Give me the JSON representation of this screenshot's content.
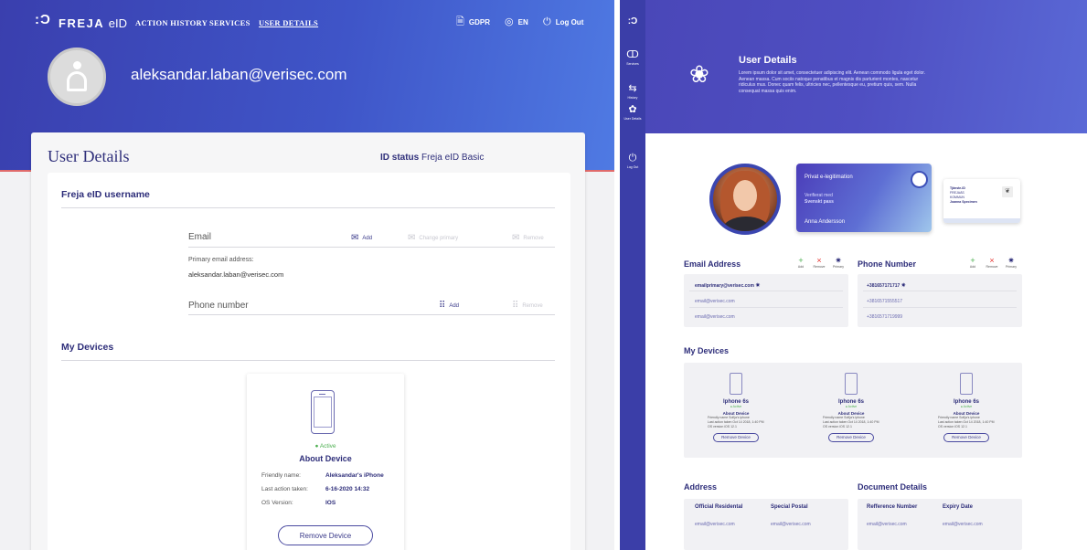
{
  "left": {
    "brand": {
      "glyph": ":Ɔ",
      "name": "FREJA",
      "suffix": "eID"
    },
    "nav": [
      {
        "label": "ACTION HISTORY"
      },
      {
        "label": "SERVICES"
      },
      {
        "label": "USER DETAILS"
      }
    ],
    "nav_right": {
      "gdpr": {
        "icon": "🗎",
        "label": "GDPR"
      },
      "lang": {
        "icon": "◎",
        "label": "EN"
      },
      "logout": {
        "icon": "⏻",
        "label": "Log Out"
      }
    },
    "hero_email": "aleksandar.laban@verisec.com",
    "card_title": "User Details",
    "id_status": {
      "label": "ID status",
      "value": "Freja eID Basic"
    },
    "username_section": "Freja eID username",
    "email_label": "Email",
    "email_actions": {
      "add": "Add",
      "change_primary": "Change primary",
      "remove": "Remove",
      "mail_icon": "✉"
    },
    "primary_email_label": "Primary email address:",
    "primary_email_value": "aleksandar.laban@verisec.com",
    "phone_label": "Phone number",
    "phone_actions": {
      "add": "Add",
      "remove": "Remove",
      "keypad_icon": "⠿"
    },
    "devices_section": "My Devices",
    "device": {
      "status": "● Active",
      "about": "About Device",
      "rows": [
        {
          "k": "Friendly name:",
          "v": "Aleksandar's iPhone"
        },
        {
          "k": "Last action taken:",
          "v": "6-16-2020 14:32"
        },
        {
          "k": "OS Version:",
          "v": "IOS"
        }
      ],
      "remove_button": "Remove Device"
    }
  },
  "right": {
    "sidebar": [
      {
        "icon": "ↀ",
        "label": "Services"
      },
      {
        "icon": "⇆",
        "label": "History"
      },
      {
        "icon": "✿",
        "label": "User Details"
      },
      {
        "icon": "⏻",
        "label": "Log Out"
      }
    ],
    "logo_glyph": ":Ɔ",
    "hero_icon": "❀",
    "title": "User Details",
    "description": "Lorem ipsum dolor sit amet, consectetuer adipiscing elit. Aenean commodo ligula eget dolor. Aenean massa. Cum sociis natoque penatibus et magnis dis parturient montes, nascetur ridiculus mus. Donec quam felis, ultricies nec, pellentesque eu, pretium quis, sem. Nulla consequat massa quis enim.",
    "eid_card": {
      "title": "Privat e-legitimation",
      "line1": "Verifierat med",
      "line2": "Svenskt pass",
      "name": "Anna Andersson"
    },
    "id_card": {
      "line1": "Tjänste-ID",
      "line2": "FREJAÄS",
      "line3": "KOMMUN",
      "line4": "Joanna Specimen"
    },
    "email_section": "Email Address",
    "phone_section": "Phone Number",
    "actions": [
      {
        "glyph": "+",
        "label": "Add",
        "color": "#4caf50"
      },
      {
        "glyph": "×",
        "label": "Remove",
        "color": "#e53935"
      },
      {
        "glyph": "✷",
        "label": "Primary",
        "color": "#2e2e7a"
      }
    ],
    "emails": [
      "emailprimary@verisec.com",
      "email@verisec.com",
      "email@verisec.com"
    ],
    "phones": [
      "+381657171717",
      "+3816571555517",
      "+3816571719999"
    ],
    "primary_mark": "✷",
    "devices_section": "My Devices",
    "devices": [
      {
        "name": "Iphone 6s",
        "status": "● Active",
        "about": "About Device",
        "kv": [
          "Friendly name    Sofija's iphone",
          "Last action taken    Oct 14 2018, 1:40 PM",
          "OS version    iOS 12.1"
        ],
        "remove": "Remove Device"
      },
      {
        "name": "Iphone 6s",
        "status": "● Active",
        "about": "About Device",
        "kv": [
          "Friendly name    Sofija's iphone",
          "Last action taken    Oct 14 2018, 1:40 PM",
          "OS version    iOS 12.1"
        ],
        "remove": "Remove Device"
      },
      {
        "name": "Iphone 6s",
        "status": "● Active",
        "about": "About Device",
        "kv": [
          "Friendly name    Sofija's iphone",
          "Last action taken    Oct 14 2018, 1:40 PM",
          "OS version    iOS 12.1"
        ],
        "remove": "Remove Device"
      }
    ],
    "address_section": "Address",
    "address_cols": [
      {
        "h": "Official Residental",
        "v": "email@verisec.com"
      },
      {
        "h": "Special Postal",
        "v": "email@verisec.com"
      }
    ],
    "document_section": "Document Details",
    "document_cols": [
      {
        "h": "Refference Number",
        "v": "email@verisec.com"
      },
      {
        "h": "Expiry Date",
        "v": "email@verisec.com"
      }
    ]
  }
}
